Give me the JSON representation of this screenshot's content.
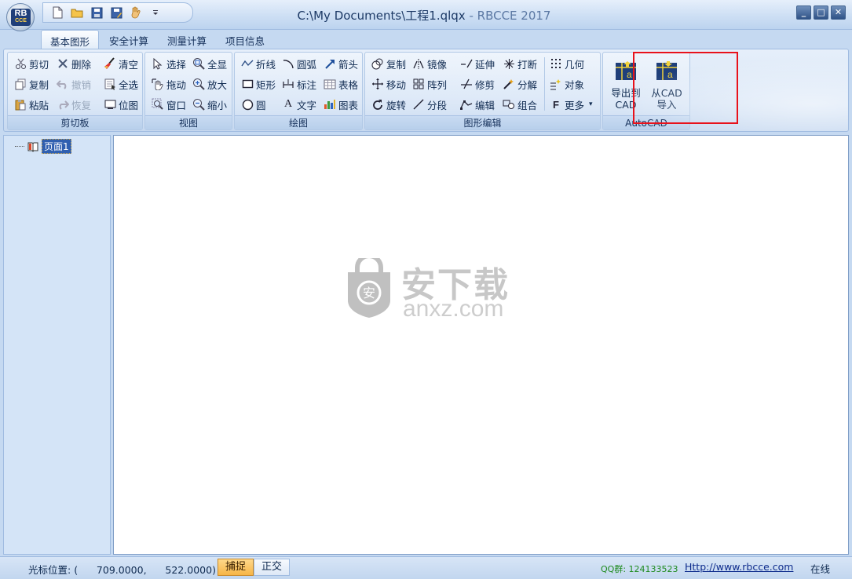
{
  "window": {
    "path": "C:\\My Documents\\工程1.qlqx",
    "separator": " - ",
    "app_name": "RBCCE 2017",
    "logo_top": "RB",
    "logo_bottom": "CCE"
  },
  "quick_access": [
    "new-icon",
    "open-folder-icon",
    "save-icon",
    "save-as-icon",
    "hand-icon",
    "dropdown-arrow-icon"
  ],
  "tabs": [
    {
      "label": "基本图形",
      "active": true
    },
    {
      "label": "安全计算",
      "active": false
    },
    {
      "label": "测量计算",
      "active": false
    },
    {
      "label": "项目信息",
      "active": false
    }
  ],
  "ribbon": {
    "clipboard": {
      "label": "剪切板",
      "cut": "剪切",
      "copy": "复制",
      "paste": "粘贴",
      "delete": "删除",
      "undo": "撤销",
      "redo": "恢复",
      "clear": "清空",
      "select_all": "全选",
      "bitmap": "位图"
    },
    "view": {
      "label": "视图",
      "select": "选择",
      "drag": "拖动",
      "window": "窗口",
      "fit_all": "全显",
      "zoom_in": "放大",
      "zoom_out": "缩小"
    },
    "draw": {
      "label": "绘图",
      "polyline": "折线",
      "rectangle": "矩形",
      "circle": "圆",
      "arc": "圆弧",
      "dimension": "标注",
      "text": "文字",
      "arrow": "箭头",
      "table": "表格",
      "chart": "图表"
    },
    "edit": {
      "label": "图形编辑",
      "copy": "复制",
      "move": "移动",
      "rotate": "旋转",
      "mirror": "镜像",
      "array": "阵列",
      "segment": "分段",
      "extend": "延伸",
      "trim": "修剪",
      "edit": "编辑",
      "break": "打断",
      "explode": "分解",
      "group": "组合",
      "geometry": "几何",
      "object": "对象",
      "more": "更多"
    },
    "autocad": {
      "label": "AutoCAD",
      "export_l1": "导出到",
      "export_l2": "CAD",
      "import_l1": "从CAD",
      "import_l2": "导入"
    }
  },
  "tree": {
    "root": "页面1"
  },
  "watermark": {
    "cn": "安下载",
    "en": "anxz.com"
  },
  "status": {
    "cursor_label": "光标位置:",
    "cursor_x": "709.0000",
    "cursor_y": "522.0000",
    "snap": "捕捉",
    "ortho": "正交",
    "qq_label": "QQ群:",
    "qq_number": "124133523",
    "website": "Http://www.rbcce.com",
    "online": "在线"
  },
  "colors": {
    "highlight": "#e8121b",
    "accent": "#2f5fb0",
    "snap_active": "#f6b547"
  }
}
